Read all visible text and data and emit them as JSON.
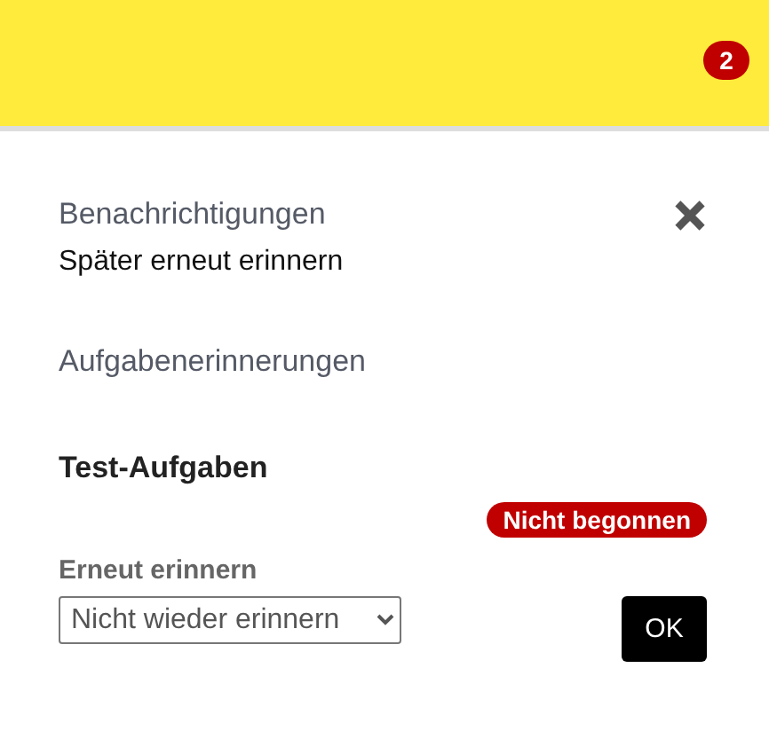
{
  "header": {
    "badge": "2"
  },
  "panel": {
    "title": "Benachrichtigungen",
    "subtitle": "Später erneut erinnern",
    "section": "Aufgabenerinnerungen",
    "task": {
      "title": "Test-Aufgaben",
      "status": "Nicht begonnen"
    },
    "remind": {
      "label": "Erneut erinnern",
      "value": "Nicht wieder erinnern"
    },
    "ok_button": "OK"
  }
}
